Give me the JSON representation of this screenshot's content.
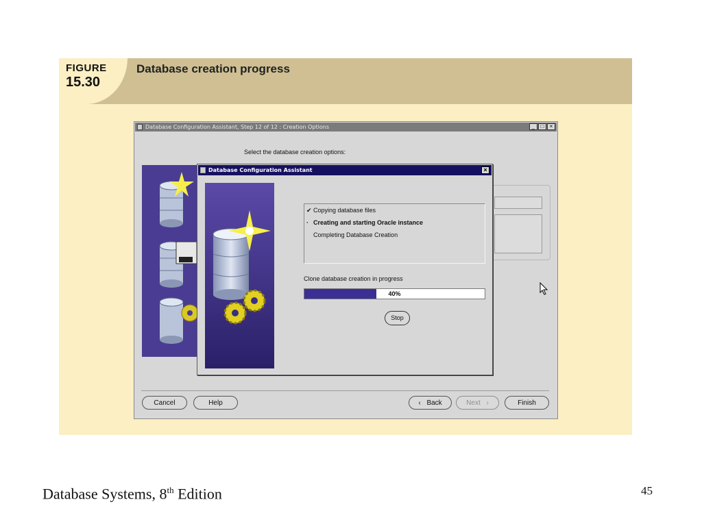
{
  "figure": {
    "label": "FIGURE",
    "number": "15.30",
    "title": "Database creation progress"
  },
  "outer_window": {
    "title": "Database Configuration Assistant, Step 12 of 12 : Creation Options",
    "controls": {
      "minimize": "_",
      "maximize": "□",
      "close": "×"
    },
    "select_label": "Select the database creation options:",
    "buttons": {
      "cancel": "Cancel",
      "help": "Help",
      "back": "Back",
      "next": "Next",
      "finish": "Finish"
    }
  },
  "dialog": {
    "title": "Database Configuration Assistant",
    "close": "×",
    "steps": [
      {
        "mark": "✔",
        "label": "Copying database files"
      },
      {
        "mark": "·",
        "label": "Creating and starting Oracle instance"
      },
      {
        "mark": "",
        "label": "Completing Database Creation"
      }
    ],
    "progress_label": "Clone database creation in progress",
    "progress_value": 0.4,
    "progress_text": "40%",
    "stop_label": "Stop"
  },
  "footer": {
    "book_prefix": "Database Systems, 8",
    "book_sup": "th",
    "book_suffix": " Edition",
    "page_number": "45"
  },
  "colors": {
    "panel": "#fbefc3",
    "header_band": "#cfbf93",
    "dialog_titlebar": "#151060",
    "progress_fill": "#3b2f94",
    "window_bg": "#d7d7d7"
  }
}
